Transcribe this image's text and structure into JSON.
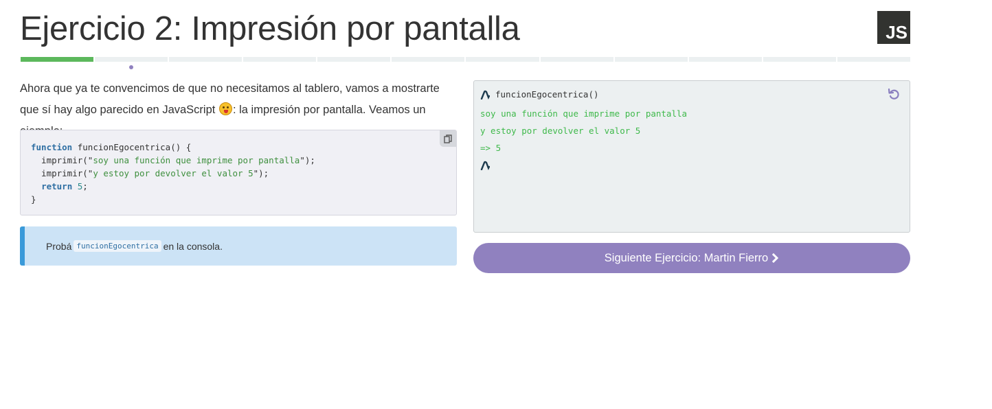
{
  "header": {
    "title": "Ejercicio 2: Impresión por pantalla",
    "language_badge": "JS"
  },
  "progress": {
    "total_segments": 12,
    "completed_segments": 1,
    "current_index": 1,
    "colors": {
      "done": "#5cb85c",
      "pending": "#ecf0f1",
      "current_dot": "#9081bf"
    }
  },
  "intro": {
    "part1": "Ahora que ya te convencimos de que no necesitamos al tablero, vamos a mostrarte que sí hay algo parecido en JavaScript ",
    "emoji": "tongue-out-emoji",
    "part2": ": la impresión por pantalla. Veamos un ejemplo:"
  },
  "code_example": {
    "kw_function": "function",
    "fn_signature": " funcionEgocentrica() {",
    "call1_start": "  imprimir(\"",
    "call1_str": "soy una función que imprime por pantalla",
    "call1_end": "\");",
    "call2_start": "  imprimir(\"",
    "call2_str": "y estoy por devolver el valor 5",
    "call2_end": "\");",
    "kw_return": "return",
    "return_value": "5",
    "return_end": ";",
    "closing": "}",
    "copy_icon": "copy-icon"
  },
  "callout": {
    "before": "Probá",
    "code": "funcionEgocentrica",
    "after": "en la consola."
  },
  "console": {
    "prompt_icon": "lambda-prompt-icon",
    "command": "funcionEgocentrica()",
    "output": [
      "soy una función que imprime por pantalla",
      "y estoy por devolver el valor 5",
      "=> 5"
    ],
    "reset_icon": "reset-icon",
    "colors": {
      "output": "#3fb94b",
      "background": "#ecf0f1"
    }
  },
  "next_button": {
    "label": "Siguiente Ejercicio: Martin Fierro",
    "icon": "chevron-right-icon",
    "color": "#9081bf"
  }
}
